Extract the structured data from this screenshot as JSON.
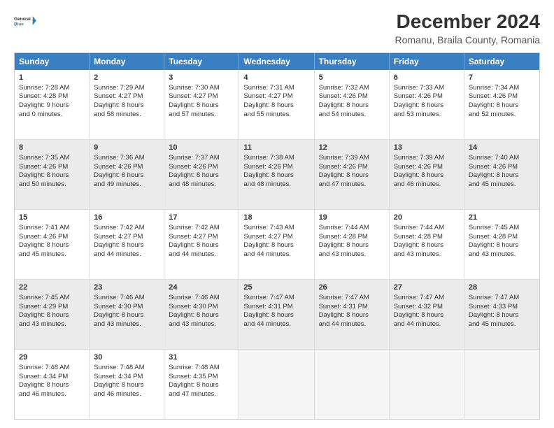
{
  "header": {
    "logo_line1": "General",
    "logo_line2": "Blue",
    "title": "December 2024",
    "subtitle": "Romanu, Braila County, Romania"
  },
  "days": [
    "Sunday",
    "Monday",
    "Tuesday",
    "Wednesday",
    "Thursday",
    "Friday",
    "Saturday"
  ],
  "rows": [
    [
      {
        "day": "1",
        "lines": [
          "Sunrise: 7:28 AM",
          "Sunset: 4:28 PM",
          "Daylight: 9 hours",
          "and 0 minutes."
        ],
        "shaded": false
      },
      {
        "day": "2",
        "lines": [
          "Sunrise: 7:29 AM",
          "Sunset: 4:27 PM",
          "Daylight: 8 hours",
          "and 58 minutes."
        ],
        "shaded": false
      },
      {
        "day": "3",
        "lines": [
          "Sunrise: 7:30 AM",
          "Sunset: 4:27 PM",
          "Daylight: 8 hours",
          "and 57 minutes."
        ],
        "shaded": false
      },
      {
        "day": "4",
        "lines": [
          "Sunrise: 7:31 AM",
          "Sunset: 4:27 PM",
          "Daylight: 8 hours",
          "and 55 minutes."
        ],
        "shaded": false
      },
      {
        "day": "5",
        "lines": [
          "Sunrise: 7:32 AM",
          "Sunset: 4:26 PM",
          "Daylight: 8 hours",
          "and 54 minutes."
        ],
        "shaded": false
      },
      {
        "day": "6",
        "lines": [
          "Sunrise: 7:33 AM",
          "Sunset: 4:26 PM",
          "Daylight: 8 hours",
          "and 53 minutes."
        ],
        "shaded": false
      },
      {
        "day": "7",
        "lines": [
          "Sunrise: 7:34 AM",
          "Sunset: 4:26 PM",
          "Daylight: 8 hours",
          "and 52 minutes."
        ],
        "shaded": false
      }
    ],
    [
      {
        "day": "8",
        "lines": [
          "Sunrise: 7:35 AM",
          "Sunset: 4:26 PM",
          "Daylight: 8 hours",
          "and 50 minutes."
        ],
        "shaded": true
      },
      {
        "day": "9",
        "lines": [
          "Sunrise: 7:36 AM",
          "Sunset: 4:26 PM",
          "Daylight: 8 hours",
          "and 49 minutes."
        ],
        "shaded": true
      },
      {
        "day": "10",
        "lines": [
          "Sunrise: 7:37 AM",
          "Sunset: 4:26 PM",
          "Daylight: 8 hours",
          "and 48 minutes."
        ],
        "shaded": true
      },
      {
        "day": "11",
        "lines": [
          "Sunrise: 7:38 AM",
          "Sunset: 4:26 PM",
          "Daylight: 8 hours",
          "and 48 minutes."
        ],
        "shaded": true
      },
      {
        "day": "12",
        "lines": [
          "Sunrise: 7:39 AM",
          "Sunset: 4:26 PM",
          "Daylight: 8 hours",
          "and 47 minutes."
        ],
        "shaded": true
      },
      {
        "day": "13",
        "lines": [
          "Sunrise: 7:39 AM",
          "Sunset: 4:26 PM",
          "Daylight: 8 hours",
          "and 46 minutes."
        ],
        "shaded": true
      },
      {
        "day": "14",
        "lines": [
          "Sunrise: 7:40 AM",
          "Sunset: 4:26 PM",
          "Daylight: 8 hours",
          "and 45 minutes."
        ],
        "shaded": true
      }
    ],
    [
      {
        "day": "15",
        "lines": [
          "Sunrise: 7:41 AM",
          "Sunset: 4:26 PM",
          "Daylight: 8 hours",
          "and 45 minutes."
        ],
        "shaded": false
      },
      {
        "day": "16",
        "lines": [
          "Sunrise: 7:42 AM",
          "Sunset: 4:27 PM",
          "Daylight: 8 hours",
          "and 44 minutes."
        ],
        "shaded": false
      },
      {
        "day": "17",
        "lines": [
          "Sunrise: 7:42 AM",
          "Sunset: 4:27 PM",
          "Daylight: 8 hours",
          "and 44 minutes."
        ],
        "shaded": false
      },
      {
        "day": "18",
        "lines": [
          "Sunrise: 7:43 AM",
          "Sunset: 4:27 PM",
          "Daylight: 8 hours",
          "and 44 minutes."
        ],
        "shaded": false
      },
      {
        "day": "19",
        "lines": [
          "Sunrise: 7:44 AM",
          "Sunset: 4:28 PM",
          "Daylight: 8 hours",
          "and 43 minutes."
        ],
        "shaded": false
      },
      {
        "day": "20",
        "lines": [
          "Sunrise: 7:44 AM",
          "Sunset: 4:28 PM",
          "Daylight: 8 hours",
          "and 43 minutes."
        ],
        "shaded": false
      },
      {
        "day": "21",
        "lines": [
          "Sunrise: 7:45 AM",
          "Sunset: 4:28 PM",
          "Daylight: 8 hours",
          "and 43 minutes."
        ],
        "shaded": false
      }
    ],
    [
      {
        "day": "22",
        "lines": [
          "Sunrise: 7:45 AM",
          "Sunset: 4:29 PM",
          "Daylight: 8 hours",
          "and 43 minutes."
        ],
        "shaded": true
      },
      {
        "day": "23",
        "lines": [
          "Sunrise: 7:46 AM",
          "Sunset: 4:30 PM",
          "Daylight: 8 hours",
          "and 43 minutes."
        ],
        "shaded": true
      },
      {
        "day": "24",
        "lines": [
          "Sunrise: 7:46 AM",
          "Sunset: 4:30 PM",
          "Daylight: 8 hours",
          "and 43 minutes."
        ],
        "shaded": true
      },
      {
        "day": "25",
        "lines": [
          "Sunrise: 7:47 AM",
          "Sunset: 4:31 PM",
          "Daylight: 8 hours",
          "and 44 minutes."
        ],
        "shaded": true
      },
      {
        "day": "26",
        "lines": [
          "Sunrise: 7:47 AM",
          "Sunset: 4:31 PM",
          "Daylight: 8 hours",
          "and 44 minutes."
        ],
        "shaded": true
      },
      {
        "day": "27",
        "lines": [
          "Sunrise: 7:47 AM",
          "Sunset: 4:32 PM",
          "Daylight: 8 hours",
          "and 44 minutes."
        ],
        "shaded": true
      },
      {
        "day": "28",
        "lines": [
          "Sunrise: 7:47 AM",
          "Sunset: 4:33 PM",
          "Daylight: 8 hours",
          "and 45 minutes."
        ],
        "shaded": true
      }
    ],
    [
      {
        "day": "29",
        "lines": [
          "Sunrise: 7:48 AM",
          "Sunset: 4:34 PM",
          "Daylight: 8 hours",
          "and 46 minutes."
        ],
        "shaded": false
      },
      {
        "day": "30",
        "lines": [
          "Sunrise: 7:48 AM",
          "Sunset: 4:34 PM",
          "Daylight: 8 hours",
          "and 46 minutes."
        ],
        "shaded": false
      },
      {
        "day": "31",
        "lines": [
          "Sunrise: 7:48 AM",
          "Sunset: 4:35 PM",
          "Daylight: 8 hours",
          "and 47 minutes."
        ],
        "shaded": false
      },
      {
        "day": "",
        "lines": [],
        "shaded": false,
        "empty": true
      },
      {
        "day": "",
        "lines": [],
        "shaded": false,
        "empty": true
      },
      {
        "day": "",
        "lines": [],
        "shaded": false,
        "empty": true
      },
      {
        "day": "",
        "lines": [],
        "shaded": false,
        "empty": true
      }
    ]
  ]
}
